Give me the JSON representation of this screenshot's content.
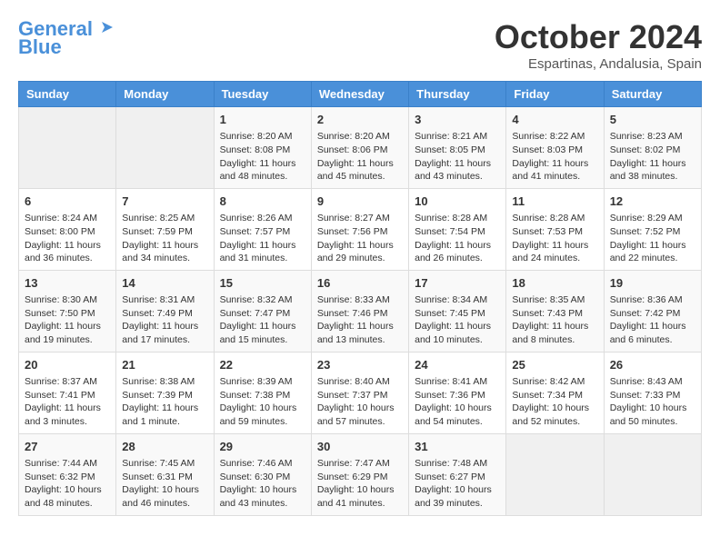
{
  "logo": {
    "line1": "General",
    "line2": "Blue"
  },
  "title": "October 2024",
  "subtitle": "Espartinas, Andalusia, Spain",
  "days_of_week": [
    "Sunday",
    "Monday",
    "Tuesday",
    "Wednesday",
    "Thursday",
    "Friday",
    "Saturday"
  ],
  "weeks": [
    [
      {
        "day": "",
        "info": ""
      },
      {
        "day": "",
        "info": ""
      },
      {
        "day": "1",
        "info": "Sunrise: 8:20 AM\nSunset: 8:08 PM\nDaylight: 11 hours and 48 minutes."
      },
      {
        "day": "2",
        "info": "Sunrise: 8:20 AM\nSunset: 8:06 PM\nDaylight: 11 hours and 45 minutes."
      },
      {
        "day": "3",
        "info": "Sunrise: 8:21 AM\nSunset: 8:05 PM\nDaylight: 11 hours and 43 minutes."
      },
      {
        "day": "4",
        "info": "Sunrise: 8:22 AM\nSunset: 8:03 PM\nDaylight: 11 hours and 41 minutes."
      },
      {
        "day": "5",
        "info": "Sunrise: 8:23 AM\nSunset: 8:02 PM\nDaylight: 11 hours and 38 minutes."
      }
    ],
    [
      {
        "day": "6",
        "info": "Sunrise: 8:24 AM\nSunset: 8:00 PM\nDaylight: 11 hours and 36 minutes."
      },
      {
        "day": "7",
        "info": "Sunrise: 8:25 AM\nSunset: 7:59 PM\nDaylight: 11 hours and 34 minutes."
      },
      {
        "day": "8",
        "info": "Sunrise: 8:26 AM\nSunset: 7:57 PM\nDaylight: 11 hours and 31 minutes."
      },
      {
        "day": "9",
        "info": "Sunrise: 8:27 AM\nSunset: 7:56 PM\nDaylight: 11 hours and 29 minutes."
      },
      {
        "day": "10",
        "info": "Sunrise: 8:28 AM\nSunset: 7:54 PM\nDaylight: 11 hours and 26 minutes."
      },
      {
        "day": "11",
        "info": "Sunrise: 8:28 AM\nSunset: 7:53 PM\nDaylight: 11 hours and 24 minutes."
      },
      {
        "day": "12",
        "info": "Sunrise: 8:29 AM\nSunset: 7:52 PM\nDaylight: 11 hours and 22 minutes."
      }
    ],
    [
      {
        "day": "13",
        "info": "Sunrise: 8:30 AM\nSunset: 7:50 PM\nDaylight: 11 hours and 19 minutes."
      },
      {
        "day": "14",
        "info": "Sunrise: 8:31 AM\nSunset: 7:49 PM\nDaylight: 11 hours and 17 minutes."
      },
      {
        "day": "15",
        "info": "Sunrise: 8:32 AM\nSunset: 7:47 PM\nDaylight: 11 hours and 15 minutes."
      },
      {
        "day": "16",
        "info": "Sunrise: 8:33 AM\nSunset: 7:46 PM\nDaylight: 11 hours and 13 minutes."
      },
      {
        "day": "17",
        "info": "Sunrise: 8:34 AM\nSunset: 7:45 PM\nDaylight: 11 hours and 10 minutes."
      },
      {
        "day": "18",
        "info": "Sunrise: 8:35 AM\nSunset: 7:43 PM\nDaylight: 11 hours and 8 minutes."
      },
      {
        "day": "19",
        "info": "Sunrise: 8:36 AM\nSunset: 7:42 PM\nDaylight: 11 hours and 6 minutes."
      }
    ],
    [
      {
        "day": "20",
        "info": "Sunrise: 8:37 AM\nSunset: 7:41 PM\nDaylight: 11 hours and 3 minutes."
      },
      {
        "day": "21",
        "info": "Sunrise: 8:38 AM\nSunset: 7:39 PM\nDaylight: 11 hours and 1 minute."
      },
      {
        "day": "22",
        "info": "Sunrise: 8:39 AM\nSunset: 7:38 PM\nDaylight: 10 hours and 59 minutes."
      },
      {
        "day": "23",
        "info": "Sunrise: 8:40 AM\nSunset: 7:37 PM\nDaylight: 10 hours and 57 minutes."
      },
      {
        "day": "24",
        "info": "Sunrise: 8:41 AM\nSunset: 7:36 PM\nDaylight: 10 hours and 54 minutes."
      },
      {
        "day": "25",
        "info": "Sunrise: 8:42 AM\nSunset: 7:34 PM\nDaylight: 10 hours and 52 minutes."
      },
      {
        "day": "26",
        "info": "Sunrise: 8:43 AM\nSunset: 7:33 PM\nDaylight: 10 hours and 50 minutes."
      }
    ],
    [
      {
        "day": "27",
        "info": "Sunrise: 7:44 AM\nSunset: 6:32 PM\nDaylight: 10 hours and 48 minutes."
      },
      {
        "day": "28",
        "info": "Sunrise: 7:45 AM\nSunset: 6:31 PM\nDaylight: 10 hours and 46 minutes."
      },
      {
        "day": "29",
        "info": "Sunrise: 7:46 AM\nSunset: 6:30 PM\nDaylight: 10 hours and 43 minutes."
      },
      {
        "day": "30",
        "info": "Sunrise: 7:47 AM\nSunset: 6:29 PM\nDaylight: 10 hours and 41 minutes."
      },
      {
        "day": "31",
        "info": "Sunrise: 7:48 AM\nSunset: 6:27 PM\nDaylight: 10 hours and 39 minutes."
      },
      {
        "day": "",
        "info": ""
      },
      {
        "day": "",
        "info": ""
      }
    ]
  ]
}
